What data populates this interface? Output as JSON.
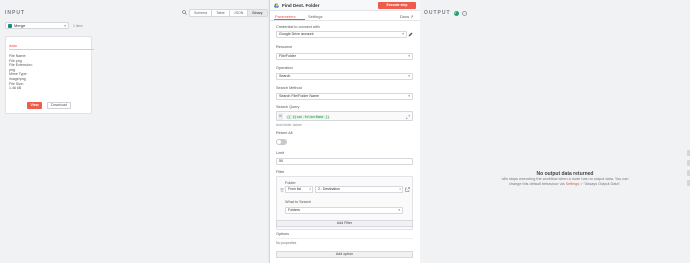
{
  "input_panel": {
    "title": "INPUT",
    "views": [
      "Schema",
      "Table",
      "JSON",
      "Binary"
    ],
    "active_view": "Binary",
    "node_select": "Merge",
    "item_count": "1 item",
    "binary": {
      "title": "data",
      "fields": [
        "File Name:",
        "File.png",
        "File Extension:",
        "png",
        "Mime Type:",
        "image/png",
        "File Size:",
        "1.46 kB"
      ],
      "view_label": "View",
      "download_label": "Download"
    }
  },
  "node": {
    "title": "Find Dest. Folder",
    "execute_label": "Execute step",
    "tabs": [
      "Parameters",
      "Settings"
    ],
    "docs_label": "Docs ↗",
    "credential_label": "Credential to connect with",
    "credential_value": "Google Drive account",
    "resource_label": "Resource",
    "resource_value": "File/Folder",
    "operation_label": "Operation",
    "operation_value": "Search",
    "search_method_label": "Search Method",
    "search_method_value": "Search File/Folder Name",
    "search_query_label": "Search Query",
    "search_query_expr": "{{ $json.folderName }}",
    "fx_label": "fx",
    "search_query_hint": "Anot folder Jacket",
    "return_all_label": "Return All",
    "limit_label": "Limit",
    "limit_value": "50",
    "filter_label": "Filter",
    "folder_label": "Folder",
    "folder_mode": "From list",
    "folder_value": "2 - Destination",
    "what_to_search_label": "What to Search",
    "what_to_search_value": "Folders",
    "add_filter_label": "Add Filter",
    "options_label": "Options",
    "no_properties": "No properties",
    "add_option_label": "Add option"
  },
  "output_panel": {
    "title": "OUTPUT",
    "no_output_title": "No output data returned",
    "no_output_msg_1": "n8n stops executing the workflow when a node has no output data. You can change this default behaviour via ",
    "no_output_link": "Settings",
    "no_output_msg_2": " > \"Always Output Data\"."
  }
}
